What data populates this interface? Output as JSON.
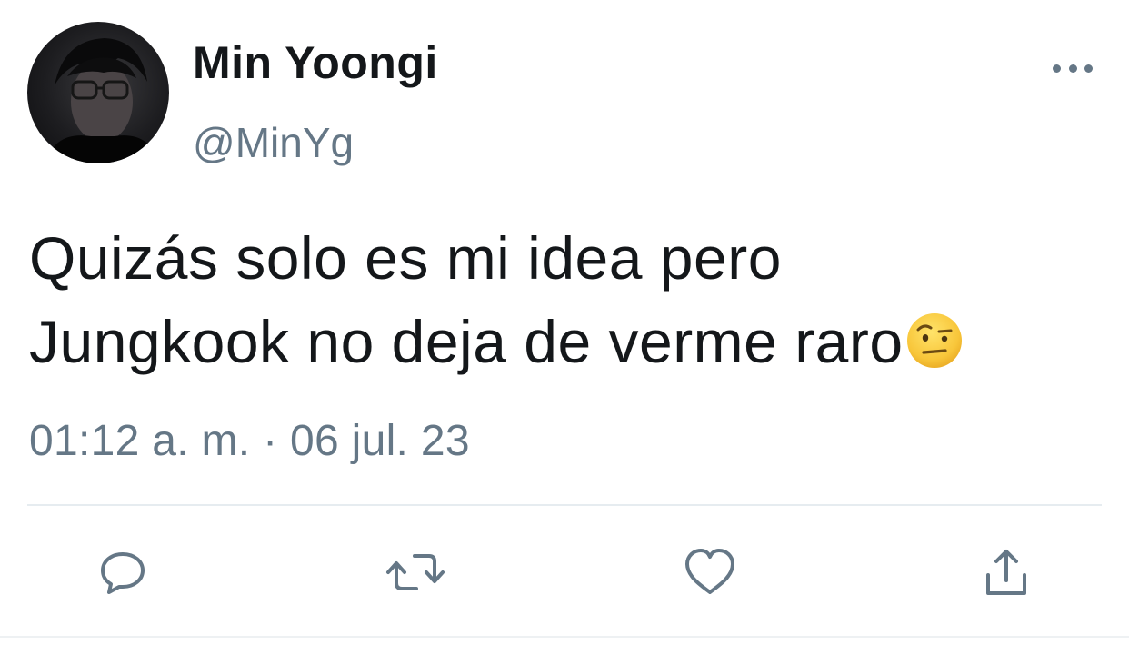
{
  "tweet": {
    "display_name": "Min Yoongi",
    "handle": "@MinYg",
    "text_line_1": "Quizás solo es mi idea pero",
    "text_line_2": "Jungkook no deja de verme raro",
    "emoji": "face-with-raised-eyebrow",
    "timestamp": "01:12 a. m. · 06 jul. 23"
  },
  "icons": {
    "more": "more-horizontal-icon",
    "reply": "reply-icon",
    "retweet": "retweet-icon",
    "like": "heart-icon",
    "share": "share-icon"
  },
  "colors": {
    "text_primary": "#14171a",
    "text_secondary": "#657786",
    "divider": "#e6ecf0",
    "background": "#ffffff"
  }
}
